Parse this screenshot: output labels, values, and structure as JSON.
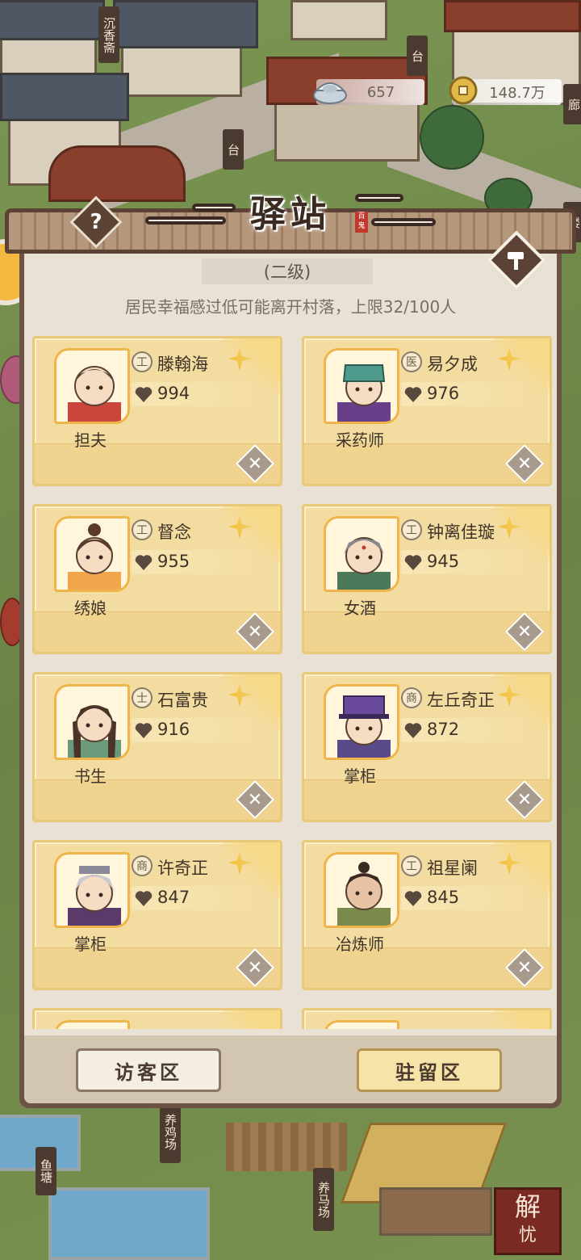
{
  "header": {
    "currency1": {
      "icon": "silver-ingot-icon",
      "value": "657"
    },
    "currency2": {
      "icon": "copper-coin-icon",
      "value": "148.7万"
    }
  },
  "map_labels": {
    "shop1": "沉香斋",
    "platform1": "台",
    "platform2": "台",
    "right_tower": "廊",
    "right_building": "楼",
    "chicken_farm": "养鸡场",
    "fish_pond": "鱼塘",
    "horse_farm": "养马场"
  },
  "panel": {
    "title": "驿站",
    "title_seal": "百鬼",
    "level": "(二级)",
    "notice": "居民幸福感过低可能离开村落，上限32/100人",
    "help_label": "?"
  },
  "residents": [
    {
      "job": "担夫",
      "type": "工",
      "name": "滕翰海",
      "happiness": "994"
    },
    {
      "job": "采药师",
      "type": "医",
      "name": "易夕成",
      "happiness": "976"
    },
    {
      "job": "绣娘",
      "type": "工",
      "name": "督念",
      "happiness": "955"
    },
    {
      "job": "女酒",
      "type": "工",
      "name": "钟离佳璇",
      "happiness": "945"
    },
    {
      "job": "书生",
      "type": "士",
      "name": "石富贵",
      "happiness": "916"
    },
    {
      "job": "掌柜",
      "type": "商",
      "name": "左丘奇正",
      "happiness": "872"
    },
    {
      "job": "掌柜",
      "type": "商",
      "name": "许奇正",
      "happiness": "847"
    },
    {
      "job": "冶炼师",
      "type": "工",
      "name": "祖星阑",
      "happiness": "845"
    },
    {
      "job": "",
      "type": "",
      "name": "",
      "happiness": ""
    },
    {
      "job": "",
      "type": "",
      "name": "",
      "happiness": ""
    }
  ],
  "tabs": {
    "visitor": "访客区",
    "resident": "驻留区"
  },
  "corner_button": {
    "line1": "解",
    "line2": "忧"
  },
  "colors": {
    "panel_frame": "#6b5244",
    "card": "#f3dca0",
    "accent": "#f0b54a"
  }
}
